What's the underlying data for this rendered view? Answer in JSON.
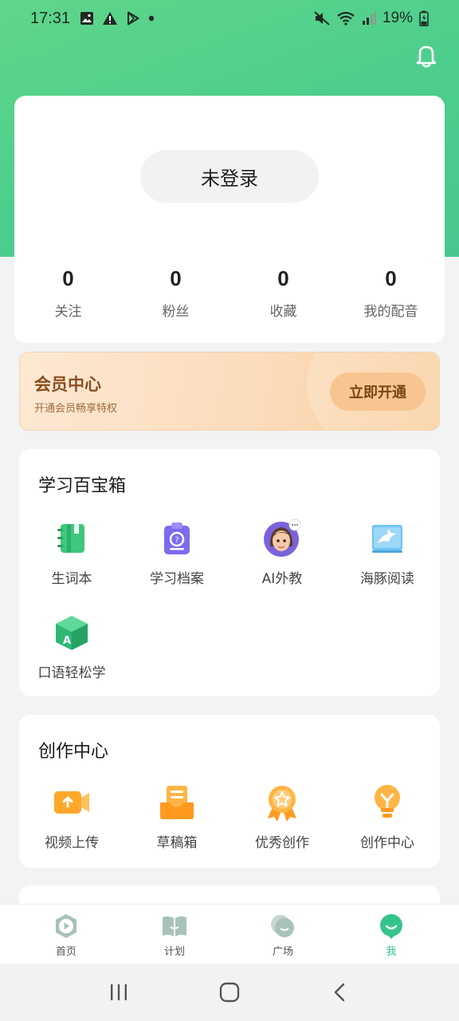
{
  "status_bar": {
    "time": "17:31",
    "battery": "19%"
  },
  "profile": {
    "login_label": "未登录",
    "stats": [
      {
        "value": "0",
        "label": "关注"
      },
      {
        "value": "0",
        "label": "粉丝"
      },
      {
        "value": "0",
        "label": "收藏"
      },
      {
        "value": "0",
        "label": "我的配音"
      }
    ]
  },
  "vip": {
    "title": "会员中心",
    "subtitle": "开通会员畅享特权",
    "button": "立即开通"
  },
  "toolbox": {
    "title": "学习百宝箱",
    "items": [
      {
        "label": "生词本",
        "icon": "notebook-icon"
      },
      {
        "label": "学习档案",
        "icon": "archive-icon"
      },
      {
        "label": "AI外教",
        "icon": "ai-tutor-avatar-icon"
      },
      {
        "label": "海豚阅读",
        "icon": "dolphin-book-icon"
      },
      {
        "label": "口语轻松学",
        "icon": "speaking-cube-icon"
      }
    ]
  },
  "creation": {
    "title": "创作中心",
    "items": [
      {
        "label": "视频上传",
        "icon": "video-upload-icon"
      },
      {
        "label": "草稿箱",
        "icon": "draft-box-icon"
      },
      {
        "label": "优秀创作",
        "icon": "award-icon"
      },
      {
        "label": "创作中心",
        "icon": "lightbulb-icon"
      }
    ]
  },
  "tabbar": {
    "tabs": [
      {
        "label": "首页",
        "icon": "play-hexagon-icon",
        "active": false
      },
      {
        "label": "计划",
        "icon": "open-book-icon",
        "active": false
      },
      {
        "label": "广场",
        "icon": "chat-bubbles-icon",
        "active": false
      },
      {
        "label": "我",
        "icon": "smile-face-icon",
        "active": true
      }
    ]
  },
  "colors": {
    "brand_green": "#4fcf8c",
    "active_tab": "#34c48a",
    "vip_text": "#8a4f1f"
  }
}
